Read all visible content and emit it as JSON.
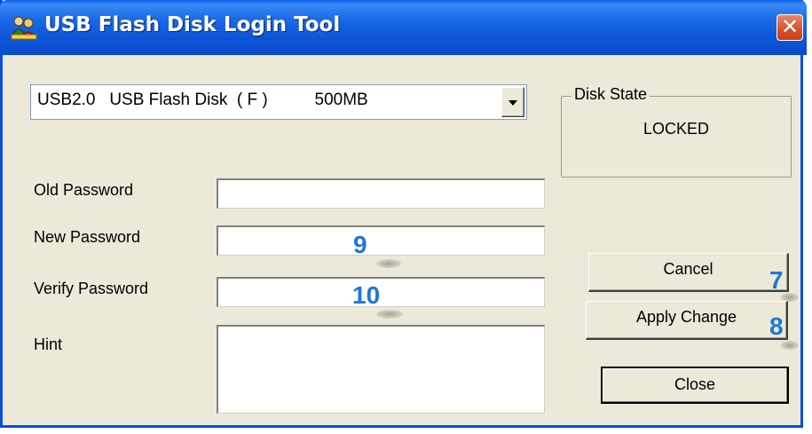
{
  "window": {
    "title": "USB Flash Disk Login Tool",
    "close_glyph": "✕",
    "title_icon": "usb-users-icon"
  },
  "device": {
    "selected": "USB2.0   USB Flash Disk  ( F )          500MB"
  },
  "disk_state": {
    "legend": "Disk State",
    "value": "LOCKED"
  },
  "form": {
    "old_password_label": "Old Password",
    "new_password_label": "New Password",
    "verify_password_label": "Verify Password",
    "hint_label": "Hint"
  },
  "buttons": {
    "cancel": "Cancel",
    "apply": "Apply Change",
    "close": "Close"
  },
  "annotations": {
    "new_password": "9",
    "verify_password": "10",
    "cancel": "7",
    "apply": "8"
  },
  "colors": {
    "titlebar": "#0d55d6",
    "window_bg": "#ece9d8",
    "annotation": "#1f77d4"
  }
}
